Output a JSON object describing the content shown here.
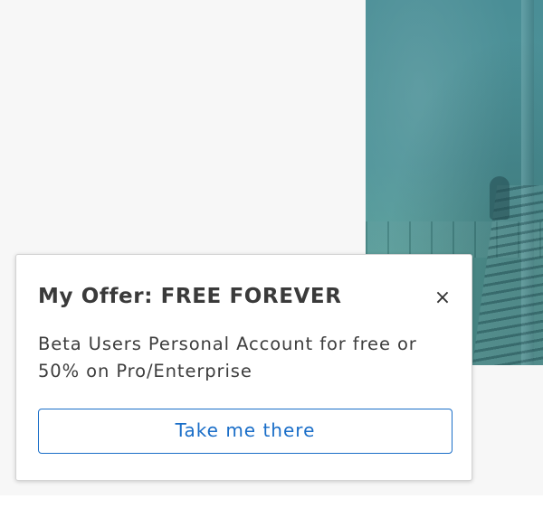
{
  "popup": {
    "title": "My Offer: FREE FOREVER",
    "close_glyph": "×",
    "message": "Beta Users Personal Account for free or 50% on Pro/Enterprise",
    "cta_label": "Take me there"
  },
  "icons": {
    "close": "close-icon"
  },
  "colors": {
    "accent": "#1a6ec8",
    "title_text": "#3a3a3a",
    "page_background": "#f7f7f7",
    "hero_teal": "#4f9499"
  }
}
